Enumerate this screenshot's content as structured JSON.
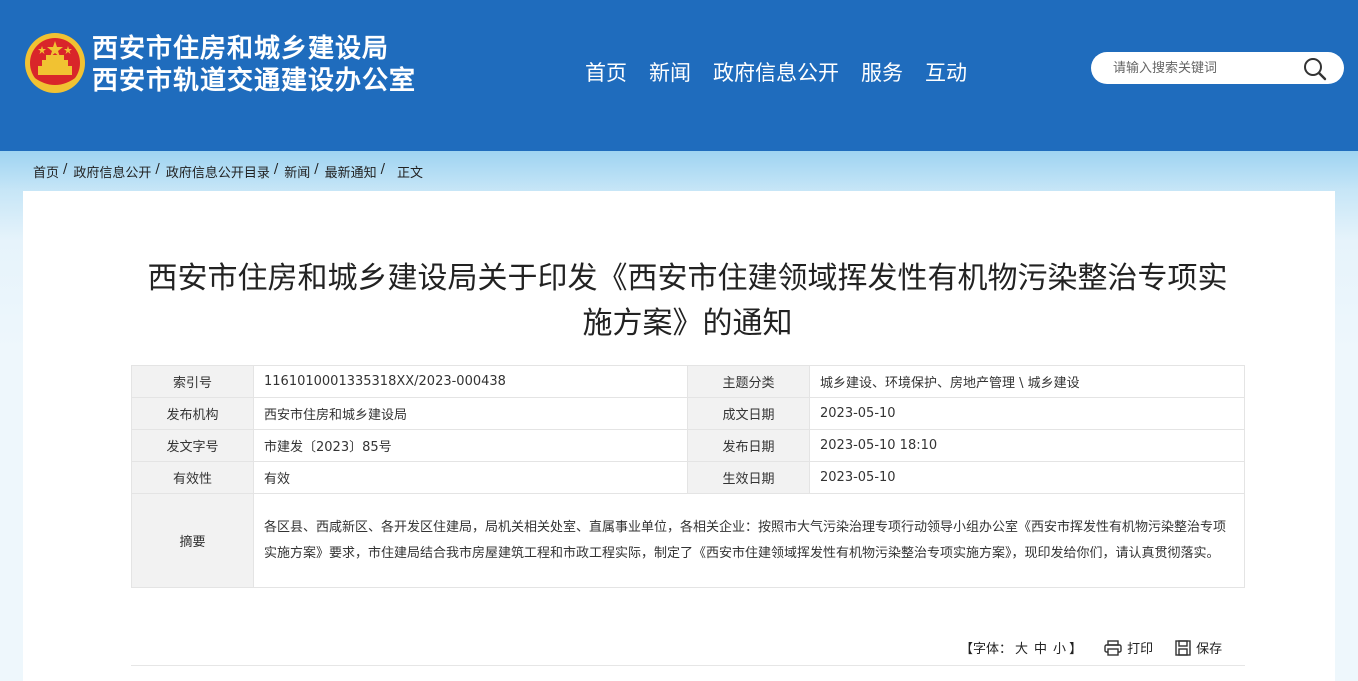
{
  "header": {
    "site_name_line1": "西安市住房和城乡建设局",
    "site_name_line2": "西安市轨道交通建设办公室",
    "nav": [
      "首页",
      "新闻",
      "政府信息公开",
      "服务",
      "互动"
    ],
    "search_placeholder": "请输入搜索关键词",
    "colors": {
      "header_bg": "#1f6cbd",
      "emblem_red": "#d9252a",
      "emblem_gold": "#f1c232"
    }
  },
  "breadcrumb": [
    "首页",
    "政府信息公开",
    "政府信息公开目录",
    "新闻",
    "最新通知",
    "正文"
  ],
  "breadcrumb_sep": "/",
  "article": {
    "title": "西安市住房和城乡建设局关于印发《西安市住建领域挥发性有机物污染整治专项实施方案》的通知"
  },
  "meta": {
    "index_label": "索引号",
    "index_value": "1161010001335318XX/2023-000438",
    "topic_label": "主题分类",
    "topic_value": "城乡建设、环境保护、房地产管理 \\ 城乡建设",
    "issuer_label": "发布机构",
    "issuer_value": "西安市住房和城乡建设局",
    "created_label": "成文日期",
    "created_value": "2023-05-10",
    "docno_label": "发文字号",
    "docno_value": "市建发〔2023〕85号",
    "published_label": "发布日期",
    "published_value": "2023-05-10 18:10",
    "validity_label": "有效性",
    "validity_value": "有效",
    "effective_label": "生效日期",
    "effective_value": "2023-05-10",
    "summary_label": "摘要",
    "summary_value": "各区县、西咸新区、各开发区住建局，局机关相关处室、直属事业单位，各相关企业：按照市大气污染治理专项行动领导小组办公室《西安市挥发性有机物污染整治专项实施方案》要求，市住建局结合我市房屋建筑工程和市政工程实际，制定了《西安市住建领域挥发性有机物污染整治专项实施方案》，现印发给你们，请认真贯彻落实。"
  },
  "tools": {
    "font_prefix": "【字体：",
    "font_large": "大",
    "font_medium": "中",
    "font_small": "小",
    "font_suffix": "】",
    "print_label": "打印",
    "save_label": "保存"
  }
}
